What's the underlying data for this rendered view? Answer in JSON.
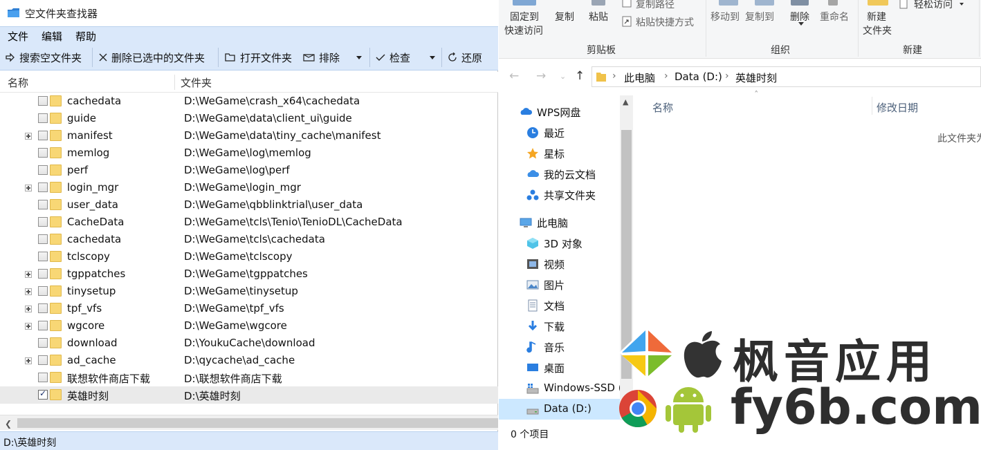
{
  "finder": {
    "title": "空文件夹查找器",
    "menu": [
      "文件",
      "编辑",
      "帮助"
    ],
    "toolbar": {
      "search": "搜索空文件夹",
      "delete_selected": "删除已选中的文件夹",
      "open_folder": "打开文件夹",
      "exclude": "排除",
      "check": "检查",
      "restore": "还原"
    },
    "columns": {
      "name": "名称",
      "folder": "文件夹"
    },
    "rows": [
      {
        "name": "cachedata",
        "path": "D:\\WeGame\\crash_x64\\cachedata",
        "expandable": false,
        "checked": false
      },
      {
        "name": "guide",
        "path": "D:\\WeGame\\data\\client_ui\\guide",
        "expandable": false,
        "checked": false
      },
      {
        "name": "manifest",
        "path": "D:\\WeGame\\data\\tiny_cache\\manifest",
        "expandable": true,
        "checked": false
      },
      {
        "name": "memlog",
        "path": "D:\\WeGame\\log\\memlog",
        "expandable": false,
        "checked": false
      },
      {
        "name": "perf",
        "path": "D:\\WeGame\\log\\perf",
        "expandable": false,
        "checked": false
      },
      {
        "name": "login_mgr",
        "path": "D:\\WeGame\\login_mgr",
        "expandable": true,
        "checked": false
      },
      {
        "name": "user_data",
        "path": "D:\\WeGame\\qbblinktrial\\user_data",
        "expandable": false,
        "checked": false
      },
      {
        "name": "CacheData",
        "path": "D:\\WeGame\\tcls\\Tenio\\TenioDL\\CacheData",
        "expandable": false,
        "checked": false
      },
      {
        "name": "cachedata",
        "path": "D:\\WeGame\\tcls\\cachedata",
        "expandable": false,
        "checked": false
      },
      {
        "name": "tclscopy",
        "path": "D:\\WeGame\\tclscopy",
        "expandable": false,
        "checked": false
      },
      {
        "name": "tgppatches",
        "path": "D:\\WeGame\\tgppatches",
        "expandable": true,
        "checked": false
      },
      {
        "name": "tinysetup",
        "path": "D:\\WeGame\\tinysetup",
        "expandable": true,
        "checked": false
      },
      {
        "name": "tpf_vfs",
        "path": "D:\\WeGame\\tpf_vfs",
        "expandable": true,
        "checked": false
      },
      {
        "name": "wgcore",
        "path": "D:\\WeGame\\wgcore",
        "expandable": true,
        "checked": false
      },
      {
        "name": "download",
        "path": "D:\\YoukuCache\\download",
        "expandable": false,
        "checked": false
      },
      {
        "name": "ad_cache",
        "path": "D:\\qycache\\ad_cache",
        "expandable": true,
        "checked": false
      },
      {
        "name": "联想软件商店下载",
        "path": "D:\\联想软件商店下载",
        "expandable": false,
        "checked": false
      },
      {
        "name": "英雄时刻",
        "path": "D:\\英雄时刻",
        "expandable": false,
        "checked": true,
        "selected": true
      }
    ],
    "status": "D:\\英雄时刻"
  },
  "explorer": {
    "ribbon": {
      "pin_line1": "固定到",
      "pin_line2": "快速访问",
      "copy": "复制",
      "paste": "粘贴",
      "copy_path": "复制路径",
      "paste_shortcut": "粘贴快捷方式",
      "move_to": "移动到",
      "copy_to": "复制到",
      "delete": "删除",
      "rename": "重命名",
      "new_folder_line1": "新建",
      "new_folder_line2": "文件夹",
      "easy_access": "轻松访问",
      "group_clipboard": "剪贴板",
      "group_organize": "组织",
      "group_new": "新建"
    },
    "breadcrumb": [
      "此电脑",
      "Data (D:)",
      "英雄时刻"
    ],
    "nav": [
      {
        "label": "WPS网盘",
        "icon": "wps-cloud-icon"
      },
      {
        "label": "最近",
        "icon": "clock-icon"
      },
      {
        "label": "星标",
        "icon": "star-icon"
      },
      {
        "label": "我的云文档",
        "icon": "cloud-docs-icon"
      },
      {
        "label": "共享文件夹",
        "icon": "shared-folder-icon"
      },
      {
        "label": "此电脑",
        "icon": "computer-icon"
      },
      {
        "label": "3D 对象",
        "icon": "3d-objects-icon"
      },
      {
        "label": "视频",
        "icon": "video-icon"
      },
      {
        "label": "图片",
        "icon": "pictures-icon"
      },
      {
        "label": "文档",
        "icon": "documents-icon"
      },
      {
        "label": "下载",
        "icon": "download-icon"
      },
      {
        "label": "音乐",
        "icon": "music-icon"
      },
      {
        "label": "桌面",
        "icon": "desktop-icon"
      },
      {
        "label": "Windows-SSD (",
        "icon": "windows-drive-icon"
      },
      {
        "label": "Data (D:)",
        "icon": "drive-icon",
        "selected": true
      }
    ],
    "columns": {
      "name": "名称",
      "date": "修改日期"
    },
    "empty_message": "此文件夹为",
    "item_count": "0 个项目"
  },
  "watermark": {
    "brand": "枫音应用",
    "domain": "fy6b.com"
  },
  "colors": {
    "menubar": "#dae8fa",
    "selection": "#cce8ff",
    "folder": "#f8d775"
  }
}
